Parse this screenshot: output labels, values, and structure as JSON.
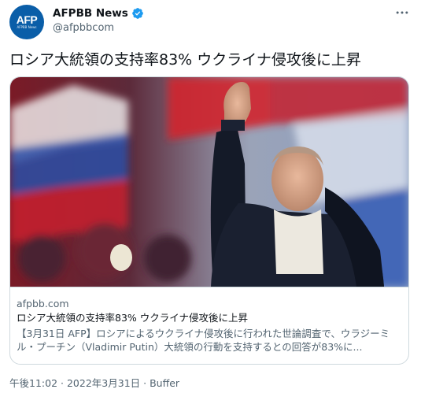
{
  "author": {
    "name": "AFPBB News",
    "handle": "@afpbbcom",
    "avatar_logo": "AFP",
    "avatar_sub": "AFPBB News",
    "verified_icon": "verified-badge-icon"
  },
  "tweet": {
    "text": "ロシア大統領の支持率83% ウクライナ侵攻後に上昇"
  },
  "card": {
    "domain": "afpbb.com",
    "title": "ロシア大統領の支持率83% ウクライナ侵攻後に上昇",
    "description": "【3月31日 AFP】ロシアによるウクライナ侵攻後に行われた世論調査で、ウラジーミル・プーチン（Vladimir Putin）大統領の行動を支持するとの回答が83%に..."
  },
  "meta": {
    "time": "午後11:02",
    "separator": "·",
    "date": "2022年3月31日",
    "separator2": "·",
    "source": "Buffer"
  },
  "colors": {
    "accent": "#1d9bf0",
    "avatar_bg": "#0a5ea8",
    "secondary_text": "#536471",
    "border": "#cfd9de"
  }
}
